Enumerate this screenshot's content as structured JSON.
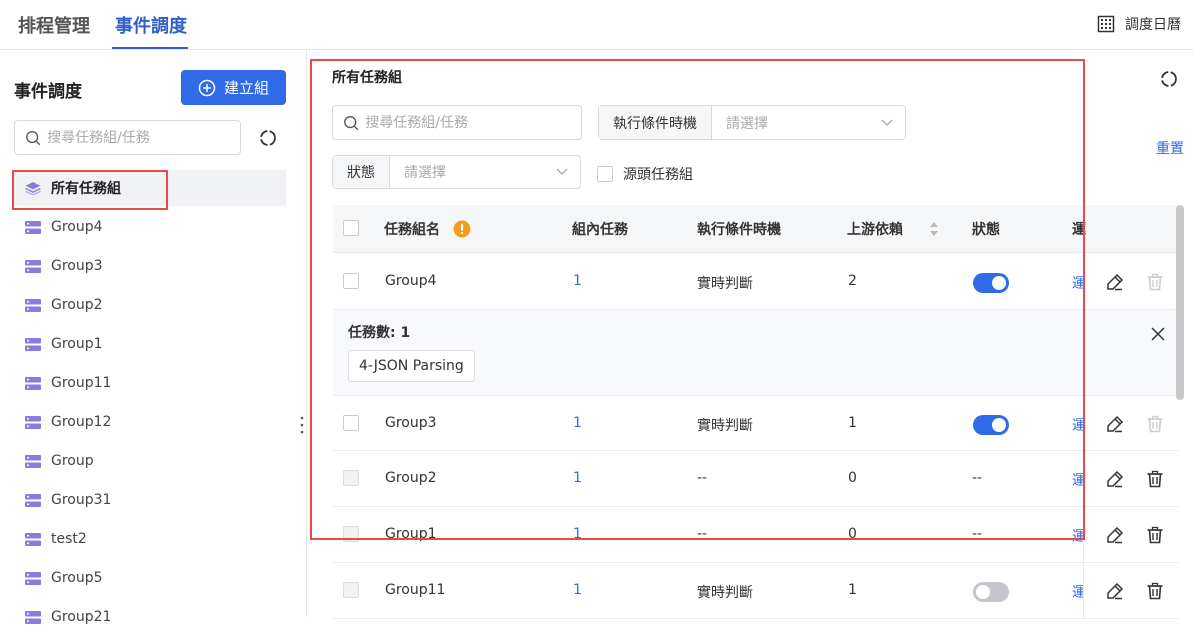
{
  "header": {
    "tabs": [
      {
        "label": "排程管理",
        "active": false
      },
      {
        "label": "事件調度",
        "active": true
      }
    ],
    "calendar_label": "調度日曆"
  },
  "sidebar": {
    "title": "事件調度",
    "create_button": "建立組",
    "search_placeholder": "搜尋任務組/任務",
    "items": [
      {
        "label": "所有任務組",
        "active": true
      },
      {
        "label": "Group4"
      },
      {
        "label": "Group3"
      },
      {
        "label": "Group2"
      },
      {
        "label": "Group1"
      },
      {
        "label": "Group11"
      },
      {
        "label": "Group12"
      },
      {
        "label": "Group"
      },
      {
        "label": "Group31"
      },
      {
        "label": "test2"
      },
      {
        "label": "Group5"
      },
      {
        "label": "Group21"
      }
    ]
  },
  "main": {
    "title": "所有任務組",
    "search_placeholder": "搜尋任務組/任務",
    "trigger_filter_label": "執行條件時機",
    "trigger_filter_placeholder": "請選擇",
    "status_filter_label": "狀態",
    "status_filter_placeholder": "請選擇",
    "source_checkbox_label": "源頭任務組",
    "reset_label": "重置",
    "columns": [
      "任務組名",
      "組內任務",
      "執行條件時機",
      "上游依賴",
      "狀態",
      "運"
    ],
    "expanded": {
      "count_label": "任務數:",
      "count_value": "1",
      "tags": [
        "4-JSON Parsing"
      ]
    },
    "rows": [
      {
        "name": "Group4",
        "tasks": "1",
        "trigger": "實時判斷",
        "upstream": "2",
        "status": "on",
        "op": "運",
        "can_delete": false
      },
      {
        "name": "Group3",
        "tasks": "1",
        "trigger": "實時判斷",
        "upstream": "1",
        "status": "on",
        "op": "運",
        "can_delete": false
      },
      {
        "name": "Group2",
        "tasks": "1",
        "trigger": "--",
        "upstream": "0",
        "status": "--",
        "op": "運",
        "can_delete": true
      },
      {
        "name": "Group1",
        "tasks": "1",
        "trigger": "--",
        "upstream": "0",
        "status": "--",
        "op": "運",
        "can_delete": true
      },
      {
        "name": "Group11",
        "tasks": "1",
        "trigger": "實時判斷",
        "upstream": "1",
        "status": "off",
        "op": "運",
        "can_delete": true
      }
    ]
  },
  "colors": {
    "accent": "#2f6ae8",
    "highlight_box": "#e84a4a",
    "warning": "#f0a020",
    "group_icon": "#8a7bdc"
  }
}
